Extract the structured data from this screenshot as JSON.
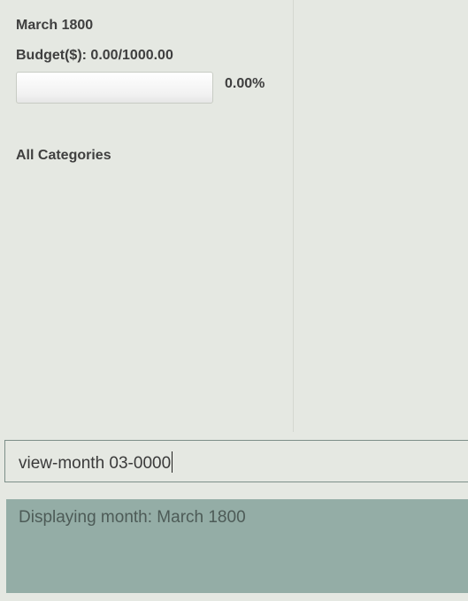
{
  "budget_panel": {
    "month_title": "March 1800",
    "budget_text": "Budget($): 0.00/1000.00",
    "progress_fraction": 0.0,
    "percent_text": "0.00%",
    "categories_heading": "All Categories"
  },
  "command_input": {
    "value": "view-month 03-0000"
  },
  "result_display": {
    "text": "Displaying month: March 1800"
  },
  "colors": {
    "background": "#e5e8e2",
    "result_box": "#94ada6",
    "command_border": "#7d8f89",
    "text": "#3f3f3f"
  }
}
